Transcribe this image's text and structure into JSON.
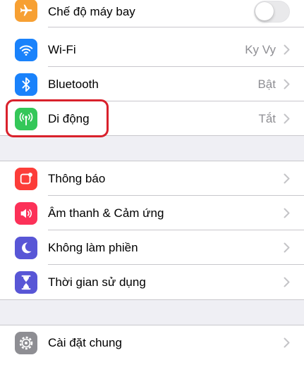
{
  "colors": {
    "airplane": "#f7a033",
    "wifi": "#1a82fb",
    "bluetooth": "#1a82fb",
    "cellular": "#34c759",
    "notifications": "#fc3d39",
    "sounds": "#fc3158",
    "do_not_disturb": "#5856d6",
    "screen_time": "#5856d6",
    "general": "#8e8e93",
    "highlight": "#d9212c"
  },
  "group1": [
    {
      "id": "airplane",
      "icon": "airplane-icon",
      "label": "Chế độ máy bay",
      "toggle": false
    },
    {
      "id": "wifi",
      "icon": "wifi-icon",
      "label": "Wi-Fi",
      "value": "Ky Vy"
    },
    {
      "id": "bluetooth",
      "icon": "bluetooth-icon",
      "label": "Bluetooth",
      "value": "Bật"
    },
    {
      "id": "cellular",
      "icon": "cellular-icon",
      "label": "Di động",
      "value": "Tắt"
    }
  ],
  "group2": [
    {
      "id": "notifications",
      "icon": "notifications-icon",
      "label": "Thông báo"
    },
    {
      "id": "sounds",
      "icon": "speaker-icon",
      "label": "Âm thanh & Cảm ứng"
    },
    {
      "id": "do_not_disturb",
      "icon": "moon-icon",
      "label": "Không làm phiền"
    },
    {
      "id": "screen_time",
      "icon": "hourglass-icon",
      "label": "Thời gian sử dụng"
    }
  ],
  "group3": [
    {
      "id": "general",
      "icon": "gear-icon",
      "label": "Cài đặt chung"
    }
  ]
}
